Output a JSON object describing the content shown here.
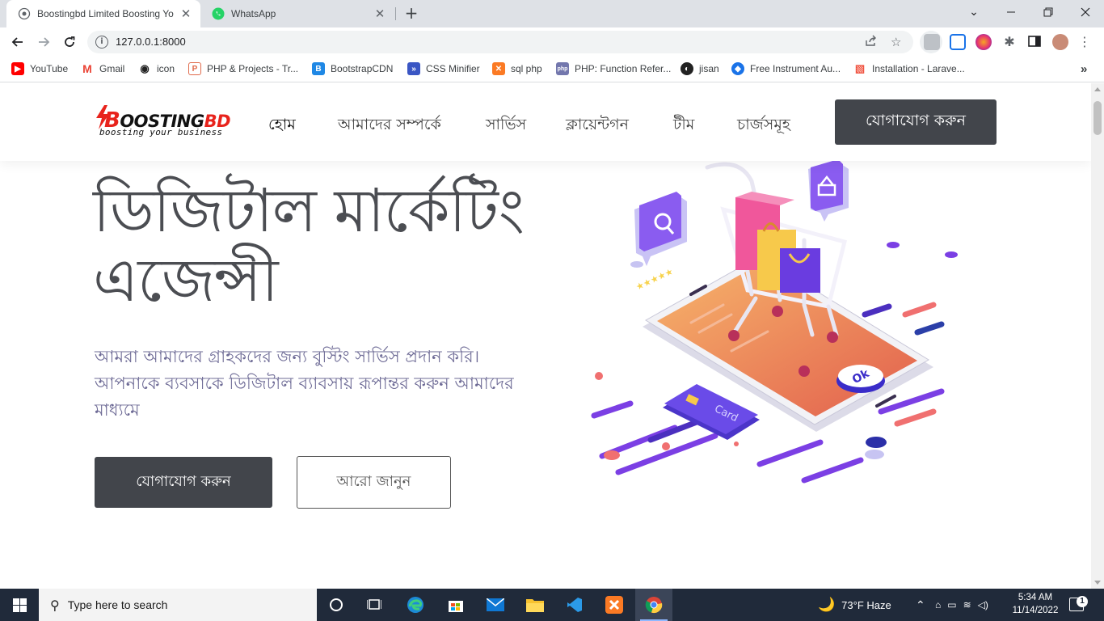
{
  "browser": {
    "tabs": [
      {
        "title": "Boostingbd Limited Boosting Yo",
        "active": true
      },
      {
        "title": "WhatsApp",
        "active": false
      }
    ],
    "url": "127.0.0.1:8000",
    "bookmarks": [
      {
        "label": "YouTube",
        "icon": "youtube-icon"
      },
      {
        "label": "Gmail",
        "icon": "gmail-icon"
      },
      {
        "label": "icon",
        "icon": "icon-site-icon"
      },
      {
        "label": "PHP & Projects - Tr...",
        "icon": "php-projects-icon"
      },
      {
        "label": "BootstrapCDN",
        "icon": "bootstrap-icon"
      },
      {
        "label": "CSS Minifier",
        "icon": "css-minifier-icon"
      },
      {
        "label": "sql php",
        "icon": "xampp-icon"
      },
      {
        "label": "PHP: Function Refer...",
        "icon": "php-icon"
      },
      {
        "label": "jisan",
        "icon": "github-icon"
      },
      {
        "label": "Free Instrument Au...",
        "icon": "instrument-icon"
      },
      {
        "label": "Installation - Larave...",
        "icon": "laravel-icon"
      }
    ],
    "more_bookmarks": "»"
  },
  "site": {
    "logo_text_b": "B",
    "logo_text_rest": "OOSTING",
    "logo_text_bd": "BD",
    "logo_tagline": "boosting your business",
    "nav": [
      "হোম",
      "আমাদের সম্পর্কে",
      "সার্ভিস",
      "ক্লায়েন্টগন",
      "টীম",
      "চার্জসমূহ"
    ],
    "header_cta": "যোগাযোগ করুন",
    "hero_title": "ডিজিটাল মার্কেটিং এজেন্সী",
    "hero_subtitle": "আমরা আমাদের গ্রাহকদের জন্য বুস্টিং সার্ভিস প্রদান করি। আপনাকে ব্যবসাকে ডিজিটাল ব্যাবসায় রূপান্তর করুন আমাদের মাধ্যমে",
    "btn_primary": "যোগাযোগ করুন",
    "btn_secondary": "আরো জানুন",
    "illustration_labels": {
      "card": "Card",
      "ok": "Ok"
    }
  },
  "taskbar": {
    "search_placeholder": "Type here to search",
    "weather": "73°F  Haze",
    "time": "5:34 AM",
    "date": "11/14/2022",
    "notification_count": "1"
  },
  "colors": {
    "header_button": "#42454b",
    "hero_title": "#4b4d52",
    "hero_subtitle": "#6e6b96",
    "logo_red": "#e8231c",
    "taskbar": "#202a3a"
  }
}
